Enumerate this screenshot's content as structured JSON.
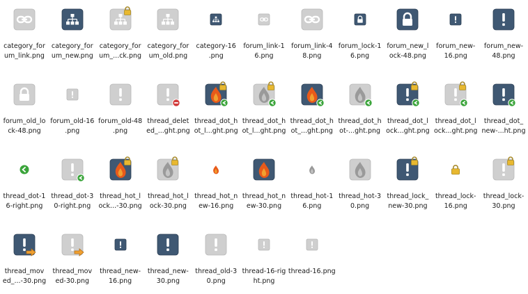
{
  "files": [
    {
      "label": "category_for\num_link.png",
      "icon": "category-link-icon"
    },
    {
      "label": "category_for\num_new.png",
      "icon": "category-new-icon"
    },
    {
      "label": "category_for\num_...ck.png",
      "icon": "category-lock-icon"
    },
    {
      "label": "category_for\num_old.png",
      "icon": "category-old-icon"
    },
    {
      "label": "category-16\n.png",
      "icon": "category-16-icon"
    },
    {
      "label": "forum_link-1\n6.png",
      "icon": "forum-link-16-icon"
    },
    {
      "label": "forum_link-4\n8.png",
      "icon": "forum-link-48-icon"
    },
    {
      "label": "forum_lock-1\n6.png",
      "icon": "forum-lock-16-icon"
    },
    {
      "label": "forum_new_l\nock-48.png",
      "icon": "forum-new-lock-48-icon"
    },
    {
      "label": "forum_new-\n16.png",
      "icon": "forum-new-16-icon"
    },
    {
      "label": "forum_new-\n48.png",
      "icon": "forum-new-48-icon"
    },
    {
      "label": "forum_old_lo\nck-48.png",
      "icon": "forum-old-lock-48-icon"
    },
    {
      "label": "forum_old-16\n.png",
      "icon": "forum-old-16-icon"
    },
    {
      "label": "forum_old-48\n.png",
      "icon": "forum-old-48-icon"
    },
    {
      "label": "thread_delet\ned_...ght.png",
      "icon": "thread-deleted-icon"
    },
    {
      "label": "thread_dot_h\not_l...ght.png",
      "icon": "thread-dot-hot-lock-icon"
    },
    {
      "label": "thread_dot_h\not_l...ght.png",
      "icon": "thread-dot-hot-lock-old-icon"
    },
    {
      "label": "thread_dot_h\not_...ght.png",
      "icon": "thread-dot-hot-icon"
    },
    {
      "label": "thread_dot_h\not-...ght.png",
      "icon": "thread-dot-hot-old-icon"
    },
    {
      "label": "thread_dot_l\nock...ght.png",
      "icon": "thread-dot-lock-new-icon"
    },
    {
      "label": "thread_dot_l\nock...ght.png",
      "icon": "thread-dot-lock-old-icon"
    },
    {
      "label": "thread_dot_\nnew-...ht.png",
      "icon": "thread-dot-new-icon"
    },
    {
      "label": "thread_dot-1\n6-right.png",
      "icon": "thread-dot-16-icon"
    },
    {
      "label": "thread_dot-3\n0-right.png",
      "icon": "thread-dot-30-icon"
    },
    {
      "label": "thread_hot_l\nock...-30.png",
      "icon": "thread-hot-lock-new-icon"
    },
    {
      "label": "thread_hot_l\nock-30.png",
      "icon": "thread-hot-lock-30-icon"
    },
    {
      "label": "thread_hot_n\new-16.png",
      "icon": "thread-hot-new-16-icon"
    },
    {
      "label": "thread_hot_n\new-30.png",
      "icon": "thread-hot-new-30-icon"
    },
    {
      "label": "thread_hot-1\n6.png",
      "icon": "thread-hot-16-icon"
    },
    {
      "label": "thread_hot-3\n0.png",
      "icon": "thread-hot-30-icon"
    },
    {
      "label": "thread_lock_\nnew-30.png",
      "icon": "thread-lock-new-30-icon"
    },
    {
      "label": "thread_lock-\n16.png",
      "icon": "thread-lock-16-icon"
    },
    {
      "label": "thread_lock-\n30.png",
      "icon": "thread-lock-30-icon"
    },
    {
      "label": "thread_mov\ned_...-30.png",
      "icon": "thread-moved-new-icon"
    },
    {
      "label": "thread_mov\ned-30.png",
      "icon": "thread-moved-30-icon"
    },
    {
      "label": "thread_new-\n16.png",
      "icon": "thread-new-16-icon"
    },
    {
      "label": "thread_new-\n30.png",
      "icon": "thread-new-30-icon"
    },
    {
      "label": "thread_old-3\n0.png",
      "icon": "thread-old-30-icon"
    },
    {
      "label": "thread-16-rig\nht.png",
      "icon": "thread-16-right-icon"
    },
    {
      "label": "thread-16.png",
      "icon": "thread-16-icon"
    }
  ],
  "colors": {
    "dark": "#3f5873",
    "light": "#cfcfcf",
    "green": "#3aa43a",
    "red": "#d23b3b",
    "gold": "#e8b830",
    "flame": "#e85a1a",
    "orange": "#f0a030"
  }
}
